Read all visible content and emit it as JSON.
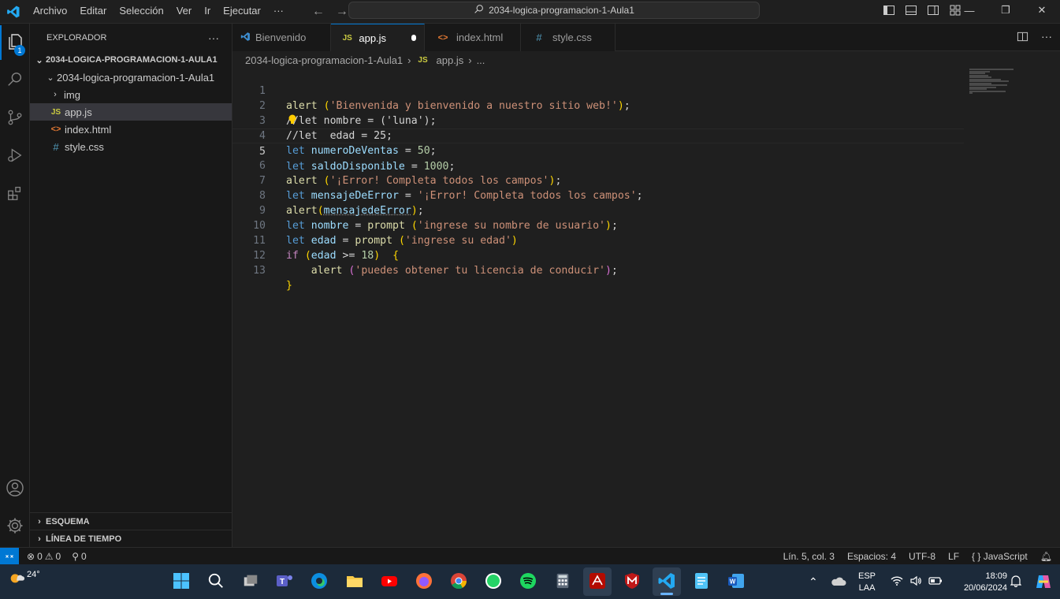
{
  "titlebar": {
    "menu": [
      "Archivo",
      "Editar",
      "Selección",
      "Ver",
      "Ir",
      "Ejecutar",
      "···"
    ],
    "search_text": "2034-logica-programacion-1-Aula1"
  },
  "activity": {
    "explorer_badge": "1"
  },
  "sidebar": {
    "header": "EXPLORADOR",
    "header_more": "···",
    "root_folder": "2034-LOGICA-PROGRAMACION-1-AULA1",
    "sub_folder": "2034-logica-programacion-1-Aula1",
    "items": [
      {
        "label": "img",
        "icon": "chevron-right-icon"
      },
      {
        "label": "app.js",
        "icon": "js-file-icon",
        "icon_text": "JS"
      },
      {
        "label": "index.html",
        "icon": "html-file-icon",
        "icon_text": "<>"
      },
      {
        "label": "style.css",
        "icon": "css-file-icon",
        "icon_text": "#"
      }
    ],
    "outline": "ESQUEMA",
    "timeline": "LÍNEA DE TIEMPO"
  },
  "tabs": [
    {
      "label": "Bienvenido"
    },
    {
      "label": "app.js",
      "icon_text": "JS"
    },
    {
      "label": "index.html",
      "icon_text": "<>"
    },
    {
      "label": "style.css",
      "icon_text": "#"
    }
  ],
  "breadcrumb": {
    "folder": "2034-logica-programacion-1-Aula1",
    "file_icon": "JS",
    "file": "app.js",
    "more": "..."
  },
  "editor": {
    "line_numbers": [
      "1",
      "2",
      "3",
      "4",
      "5",
      "6",
      "7",
      "8",
      "9",
      "10",
      "11",
      "12",
      "13"
    ],
    "current_line": "5",
    "code": {
      "l1": {
        "fn": "alert",
        "a": " ",
        "p1": "(",
        "str": "'Bienvenida y bienvenido a nuestro sitio web!'",
        "p2": ")",
        "end": ";"
      },
      "l2": "//let nombre = ('luna');",
      "l3": "//let  edad = 25;",
      "l4": {
        "kw": "let",
        "var": "numeroDeVentas",
        "op": " = ",
        "num": "50",
        "end": ";"
      },
      "l5": {
        "kw": "let",
        "var": "saldoDisponible",
        "op": " = ",
        "num": "1000",
        "end": ";"
      },
      "l6": {
        "fn": "alert",
        "a": " ",
        "p1": "(",
        "str": "'¡Error! Completa todos los campos'",
        "p2": ")",
        "end": ";"
      },
      "l7": {
        "kw": "let",
        "var": "mensajeDeError",
        "op": " = ",
        "str": "'¡Error! Completa todos los campos'",
        "end": ";"
      },
      "l8": {
        "fn": "alert",
        "p1": "(",
        "var": "mensajedeError",
        "p2": ")",
        "end": ";"
      },
      "l9": {
        "kw": "let",
        "var": "nombre",
        "op": " = ",
        "fn": "prompt",
        "a": " ",
        "p1": "(",
        "str": "'ingrese su nombre de usuario'",
        "p2": ")",
        "end": ";"
      },
      "l10": {
        "kw": "let",
        "var": "edad",
        "op": " = ",
        "fn": "prompt",
        "a": " ",
        "p1": "(",
        "str": "'ingrese su edad'",
        "p2": ")"
      },
      "l11": {
        "ctrl": "if",
        "a": " ",
        "p1": "(",
        "var": "edad",
        "op": " >= ",
        "num": "18",
        "p2": ")",
        "b": "  ",
        "brace": "{"
      },
      "l12": {
        "indent": "    ",
        "fn": "alert",
        "a": " ",
        "p1": "(",
        "str": "'puedes obtener tu licencia de conducir'",
        "p2": ")",
        "end": ";"
      },
      "l13": {
        "brace": "}"
      }
    }
  },
  "status": {
    "errors": "0",
    "warnings": "0",
    "ports": "0",
    "position": "Lín. 5, col. 3",
    "spaces": "Espacios: 4",
    "encoding": "UTF-8",
    "eol": "LF",
    "language": "JavaScript"
  },
  "taskbar": {
    "temperature": "24°",
    "lang1": "ESP",
    "lang2": "LAA",
    "time": "18:09",
    "date": "20/06/2024"
  },
  "colors": {
    "accent": "#0078d4",
    "keyword": "#569cd6",
    "function": "#dcdcaa",
    "string": "#ce9178",
    "comment": "#6a9955"
  }
}
